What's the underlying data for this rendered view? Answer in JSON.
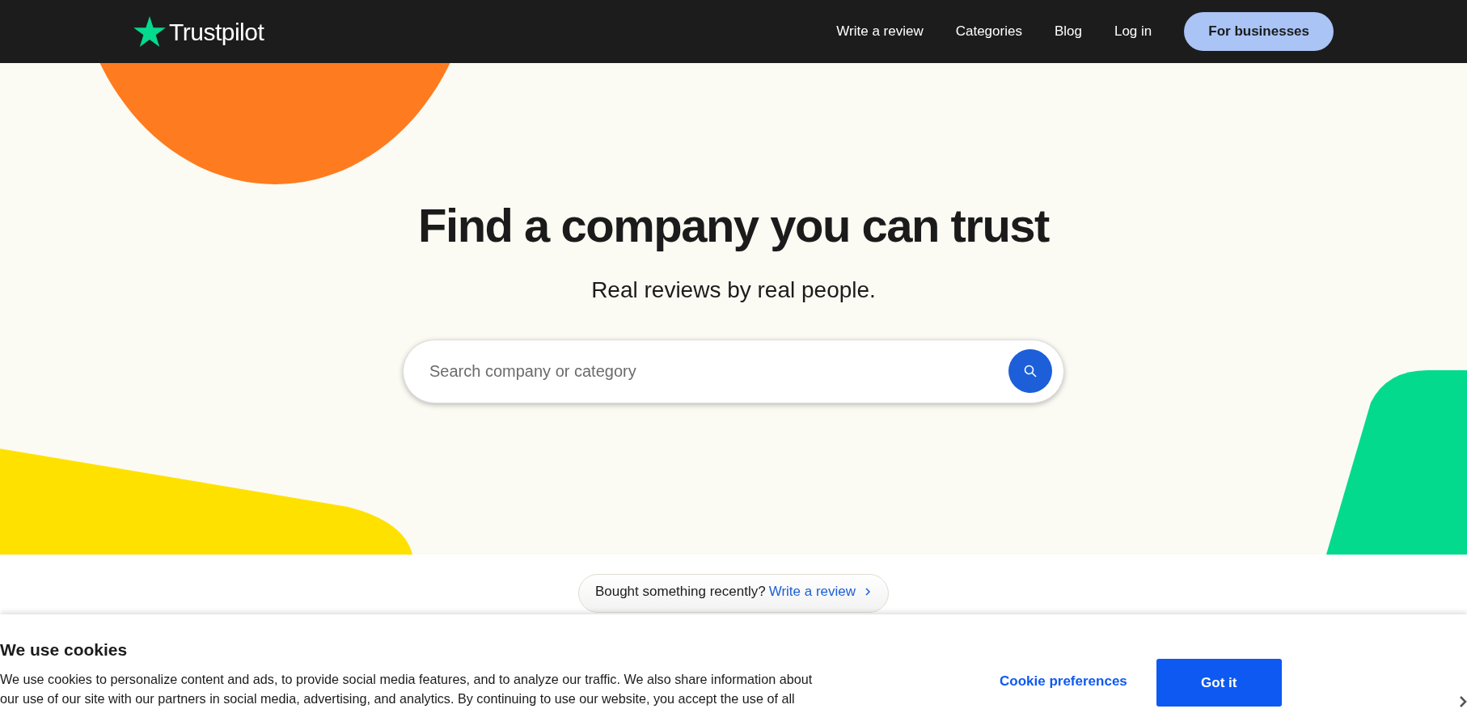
{
  "header": {
    "logo": "Trustpilot",
    "nav": [
      "Write a review",
      "Categories",
      "Blog",
      "Log in"
    ],
    "cta": "For businesses"
  },
  "hero": {
    "title": "Find a company you can trust",
    "subtitle": "Real reviews by real people.",
    "search": {
      "placeholder": "Search company or category"
    }
  },
  "prompt": {
    "text": "Bought something recently?",
    "link": "Write a review"
  },
  "cookie_banner": {
    "title": "We use cookies",
    "text": "We use cookies to personalize content and ads, to provide social media features, and to analyze our traffic. We also share information about our use of our site with our partners in social media, advertising, and analytics. By continuing to use our website, you accept the use of all",
    "buttons": [
      {
        "label": "Cookie preferences",
        "kind": "link"
      },
      {
        "label": "Got it",
        "kind": "primary"
      }
    ]
  }
}
